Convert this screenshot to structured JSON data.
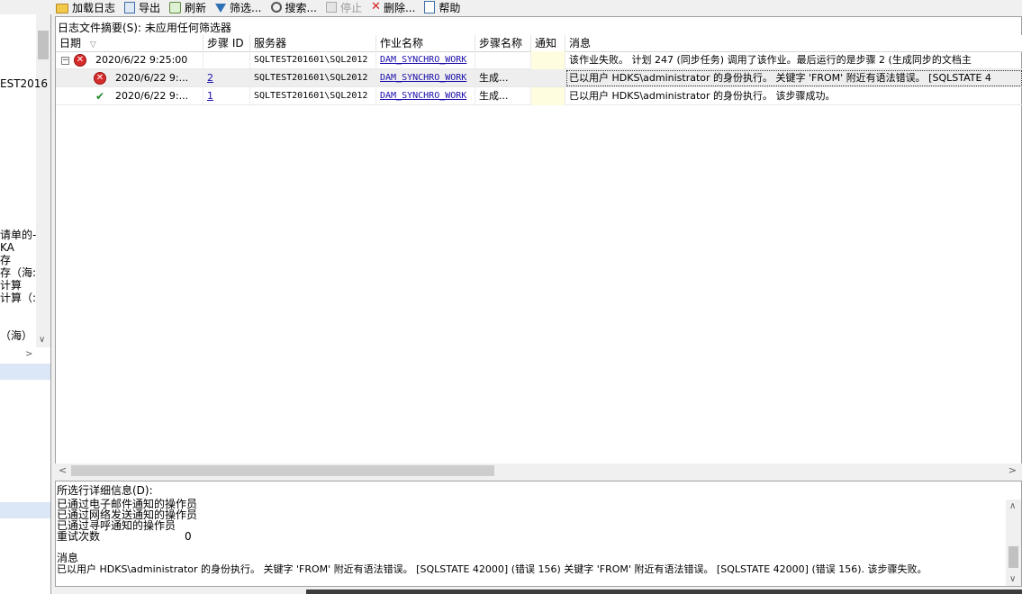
{
  "toolbar": {
    "load_log": "加载日志",
    "export": "导出",
    "refresh": "刷新",
    "filter": "筛选...",
    "search": "搜索...",
    "stop": "停止",
    "delete": "删除...",
    "help": "帮助"
  },
  "left_pane": {
    "item_server": "EST2016",
    "item_1": "请单的-",
    "item_2": "KA",
    "item_3": "存",
    "item_4": "存（海:",
    "item_5": "计算",
    "item_6": "计算（:",
    "item_7": "（海）",
    "arrow_right": ">",
    "arrow_down": "∨"
  },
  "summary": "日志文件摘要(S): 未应用任何筛选器",
  "columns": {
    "date": "日期",
    "step_id": "步骤 ID",
    "server": "服务器",
    "job_name": "作业名称",
    "step_name": "步骤名称",
    "notify": "通知",
    "message": "消息"
  },
  "rows": [
    {
      "date": "2020/6/22 9:25:00",
      "step_id": "",
      "server": "SQLTEST201601\\SQL2012",
      "job_name": "DAM_SYNCHRO_WORK",
      "step_name": "",
      "notify": "",
      "message": "该作业失败。  计划 247 (同步任务) 调用了该作业。最后运行的是步骤 2 (生成同步的文档主"
    },
    {
      "date": "2020/6/22 9:...",
      "step_id": "2",
      "server": "SQLTEST201601\\SQL2012",
      "job_name": "DAM_SYNCHRO_WORK",
      "step_name": "生成...",
      "notify": "",
      "message": "已以用户 HDKS\\administrator 的身份执行。 关键字 'FROM' 附近有语法错误。 [SQLSTATE 4"
    },
    {
      "date": "2020/6/22 9:...",
      "step_id": "1",
      "server": "SQLTEST201601\\SQL2012",
      "job_name": "DAM_SYNCHRO_WORK",
      "step_name": "生成...",
      "notify": "",
      "message": "已以用户 HDKS\\administrator 的身份执行。 该步骤成功。"
    }
  ],
  "details": {
    "title": "所选行详细信息(D):",
    "email": "已通过电子邮件通知的操作员",
    "net_send": "已通过网络发送通知的操作员",
    "pager": "已通过寻呼通知的操作员",
    "retries_label": "重试次数",
    "retries_value": "0",
    "message_label": "消息",
    "message_text": "已以用户 HDKS\\administrator 的身份执行。 关键字 'FROM' 附近有语法错误。 [SQLSTATE 42000] (错误 156)  关键字 'FROM' 附近有语法错误。 [SQLSTATE 42000] (错误 156).  该步骤失败。"
  },
  "icons": {
    "error": "error-circle-icon",
    "success": "checkmark-icon",
    "expand": "collapse-minus-icon"
  },
  "colors": {
    "link": "#1a0dab",
    "error": "#d52b2b",
    "success": "#1f8a2c",
    "notify_cell": "#fffde0"
  }
}
